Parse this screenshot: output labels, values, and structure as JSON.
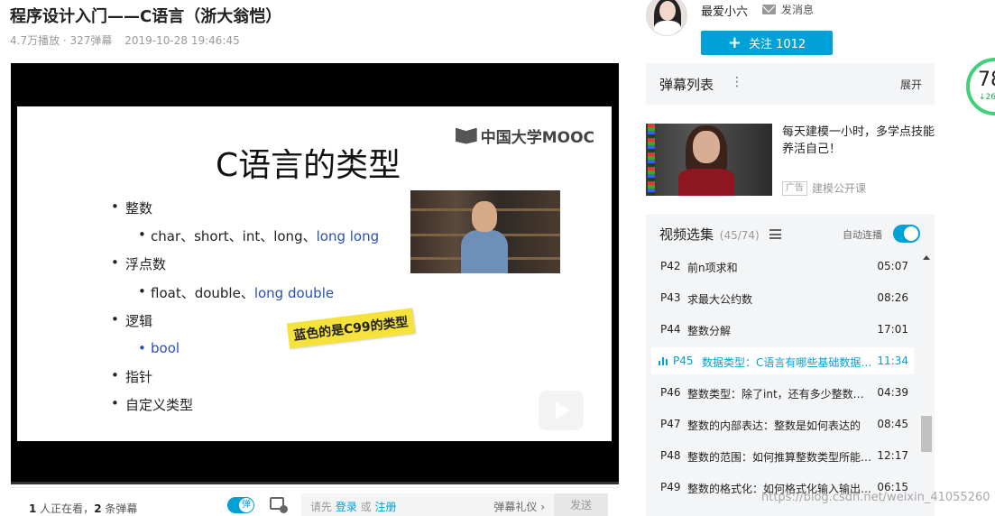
{
  "video": {
    "title": "程序设计入门——C语言（浙大翁恺）",
    "plays": "4.7万播放 · 327弹幕",
    "date": "2019-10-28 19:46:45"
  },
  "slide": {
    "logo_text": "中国大学MOOC",
    "title": "C语言的类型",
    "item_int": "整数",
    "int_types": "char、short、int、long、",
    "int_types_c99": "long long",
    "item_float": "浮点数",
    "float_types": "float、double、",
    "float_types_c99": "long double",
    "item_logic": "逻辑",
    "logic_types_c99": "bool",
    "item_pointer": "指针",
    "item_custom": "自定义类型",
    "sticker": "蓝色的是C99的类型",
    "progress_fraction": 0.0
  },
  "bottom_bar": {
    "viewer_count": "1",
    "viewers_text": " 人正在看，",
    "danmaku_count": "2",
    "danmaku_text": " 条弹幕",
    "danmaku_toggle_label": "弹",
    "input_prefix": "请先 ",
    "login": "登录",
    "or": " 或 ",
    "register": "注册",
    "gift": "弹幕礼仪 ›",
    "send": "发送"
  },
  "uploader": {
    "name": "最爱小六",
    "message": "发消息",
    "follow": "关注 1012"
  },
  "danmaku_list": {
    "title": "弹幕列表",
    "more": "⋮",
    "expand": "展开"
  },
  "speed_ring": {
    "value": "78",
    "sub": "↓26"
  },
  "ad": {
    "text": "每天建模一小时，多学点技能养活自己！",
    "tag": "广告",
    "source": "建模公开课"
  },
  "playlist": {
    "title": "视频选集",
    "count": "(45/74)",
    "autoplay": "自动连播",
    "episodes": [
      {
        "code": "P42",
        "name": "前n项求和",
        "duration": "05:07"
      },
      {
        "code": "P43",
        "name": "求最大公约数",
        "duration": "08:26"
      },
      {
        "code": "P44",
        "name": "整数分解",
        "duration": "17:01"
      },
      {
        "code": "P45",
        "name": "数据类型：C语言有哪些基础数据类型",
        "duration": "11:34"
      },
      {
        "code": "P46",
        "name": "整数类型：除了int，还有多少整数类型",
        "duration": "04:39"
      },
      {
        "code": "P47",
        "name": "整数的内部表达：整数是如何表达的",
        "duration": "08:45"
      },
      {
        "code": "P48",
        "name": "整数的范围：如何推算整数类型所能表达的范围",
        "duration": "12:17"
      },
      {
        "code": "P49",
        "name": "整数的格式化：如何格式化输入输出整数",
        "duration": "06:15"
      }
    ],
    "active_index": 3
  },
  "watermark": "https://blog.csdn.net/weixin_41055260",
  "colors": {
    "accent": "#00a1d6",
    "c99_blue": "#2850b5",
    "sticker": "#f5e23a",
    "ring": "#41d07a"
  }
}
